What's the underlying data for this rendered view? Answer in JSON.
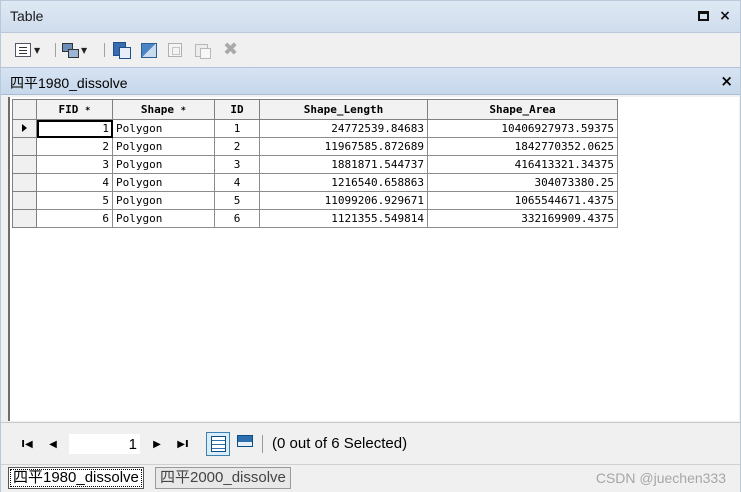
{
  "window": {
    "title": "Table"
  },
  "table": {
    "name": "四平1980_dissolve",
    "columns": [
      "FID",
      "Shape",
      "ID",
      "Shape_Length",
      "Shape_Area"
    ],
    "sort_mark": "*",
    "rows": [
      [
        "1",
        "Polygon",
        "1",
        "24772539.84683",
        "10406927973.59375"
      ],
      [
        "2",
        "Polygon",
        "2",
        "11967585.872689",
        "1842770352.0625"
      ],
      [
        "3",
        "Polygon",
        "3",
        "1881871.544737",
        "416413321.34375"
      ],
      [
        "4",
        "Polygon",
        "4",
        "1216540.658863",
        "304073380.25"
      ],
      [
        "5",
        "Polygon",
        "5",
        "11099206.929671",
        "1065544671.4375"
      ],
      [
        "6",
        "Polygon",
        "6",
        "1121355.549814",
        "332169909.4375"
      ]
    ]
  },
  "navigation": {
    "current_record": "1",
    "selection_status": "(0 out of 6 Selected)"
  },
  "tabs": [
    {
      "label": "四平1980_dissolve",
      "active": true
    },
    {
      "label": "四平2000_dissolve",
      "active": false
    }
  ],
  "watermark": "CSDN @juechen333",
  "icons": {
    "close": "×",
    "first": "I◀",
    "prev": "◀",
    "next": "▶",
    "last": "▶I",
    "row_pointer": "▶",
    "delete": "✖"
  }
}
